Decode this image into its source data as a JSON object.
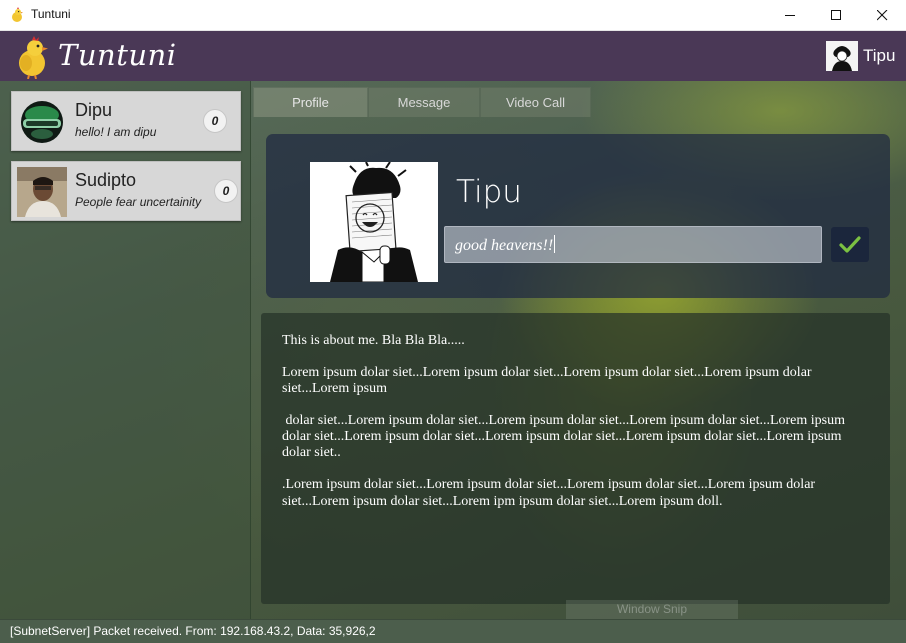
{
  "window": {
    "title": "Tuntuni",
    "controls": [
      "minimize-icon",
      "maximize-icon",
      "close-icon"
    ]
  },
  "header": {
    "brand": "Tuntuni",
    "current_user": "Tipu",
    "colors": {
      "header_bg": "#4a3856"
    }
  },
  "contacts": [
    {
      "name": "Dipu",
      "status": "hello! I am dipu",
      "unread": "0"
    },
    {
      "name": "Sudipto",
      "status": "People fear uncertainity",
      "unread": "0"
    }
  ],
  "tabs": [
    {
      "label": "Profile",
      "active": true
    },
    {
      "label": "Message",
      "active": false
    },
    {
      "label": "Video Call",
      "active": false
    }
  ],
  "profile": {
    "name": "Tipu",
    "status_input_value": "good heavens!!",
    "save_icon": "checkmark-icon"
  },
  "about": {
    "paragraphs": [
      "This is about me. Bla Bla Bla.....",
      "Lorem ipsum dolar siet...Lorem ipsum dolar siet...Lorem ipsum dolar siet...Lorem ipsum dolar siet...Lorem ipsum",
      " dolar siet...Lorem ipsum dolar siet...Lorem ipsum dolar siet...Lorem ipsum dolar siet...Lorem ipsum dolar siet...Lorem ipsum dolar siet...Lorem ipsum dolar siet...Lorem ipsum dolar siet...Lorem ipsum dolar siet..",
      ".Lorem ipsum dolar siet...Lorem ipsum dolar siet...Lorem ipsum dolar siet...Lorem ipsum dolar siet...Lorem ipsum dolar siet...Lorem ipm ipsum dolar siet...Lorem ipsum doll."
    ]
  },
  "ghost_label": "Window Snip",
  "statusbar": {
    "text": "[SubnetServer] Packet received. From: 192.168.43.2, Data: 35,926,2"
  }
}
